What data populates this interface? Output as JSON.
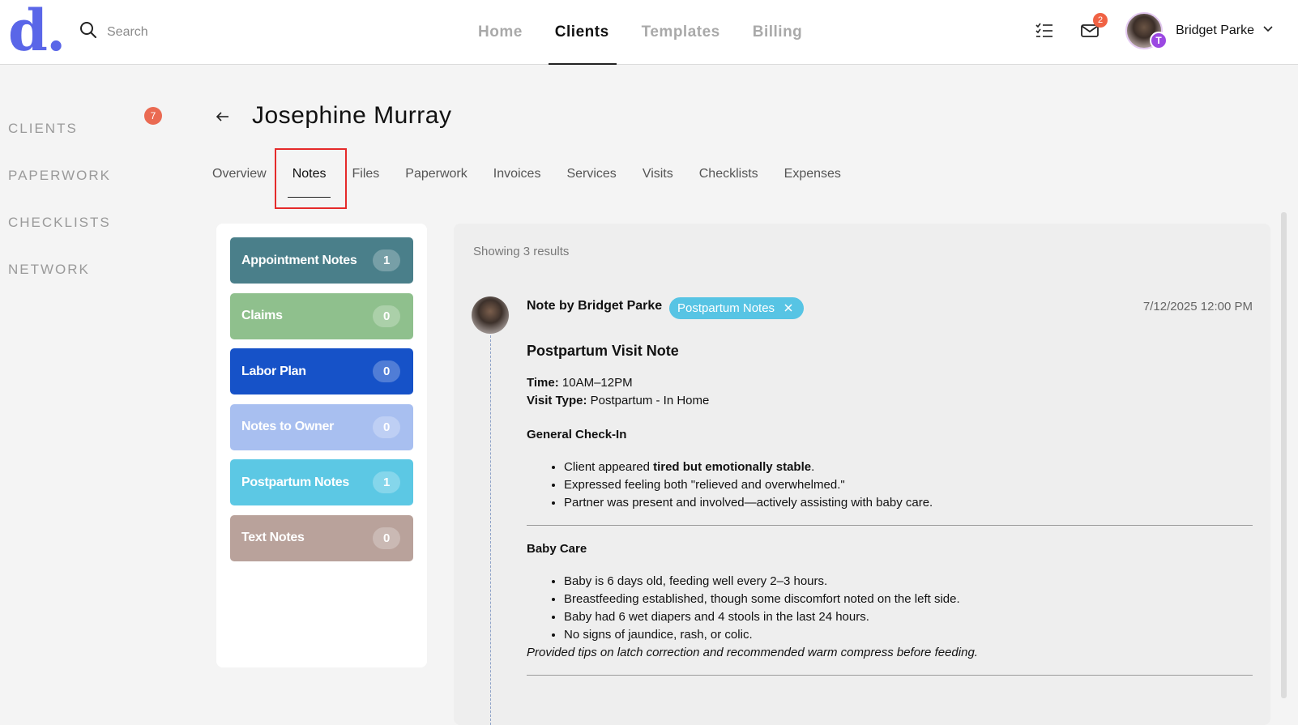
{
  "app": {
    "logo": "d."
  },
  "search": {
    "placeholder": "Search"
  },
  "nav": [
    {
      "label": "Home"
    },
    {
      "label": "Clients"
    },
    {
      "label": "Templates"
    },
    {
      "label": "Billing"
    }
  ],
  "header": {
    "mail_count": "2",
    "user_name": "Bridget Parke",
    "avatar_initial": "T"
  },
  "sidebar": {
    "items": [
      {
        "label": "CLIENTS",
        "badge": "7"
      },
      {
        "label": "PAPERWORK"
      },
      {
        "label": "CHECKLISTS"
      },
      {
        "label": "NETWORK"
      }
    ]
  },
  "client": {
    "name": "Josephine Murray"
  },
  "tabs": [
    {
      "label": "Overview"
    },
    {
      "label": "Notes"
    },
    {
      "label": "Files"
    },
    {
      "label": "Paperwork"
    },
    {
      "label": "Invoices"
    },
    {
      "label": "Services"
    },
    {
      "label": "Visits"
    },
    {
      "label": "Checklists"
    },
    {
      "label": "Expenses"
    }
  ],
  "categories": [
    {
      "label": "Appointment Notes",
      "count": "1",
      "color": "#4a7f8a"
    },
    {
      "label": "Claims",
      "count": "0",
      "color": "#8fc08d"
    },
    {
      "label": "Labor Plan",
      "count": "0",
      "color": "#1652c8"
    },
    {
      "label": "Notes to Owner",
      "count": "0",
      "color": "#a8bff0"
    },
    {
      "label": "Postpartum Notes",
      "count": "1",
      "color": "#5cc8e4"
    },
    {
      "label": "Text Notes",
      "count": "0",
      "color": "#b9a29b"
    }
  ],
  "notes": {
    "results_text": "Showing 3 results",
    "note": {
      "author": "Note by Bridget Parke",
      "tag": "Postpartum Notes",
      "date": "7/12/2025 12:00 PM",
      "title": "Postpartum Visit Note",
      "time_label": "Time:",
      "time_value": " 10AM–12PM",
      "visit_type_label": "Visit Type:",
      "visit_type_value": " Postpartum - In Home",
      "section1_title": "General Check-In",
      "section1_item1_pre": "Client appeared ",
      "section1_item1_bold": "tired but emotionally stable",
      "section1_item1_post": ".",
      "section1_item2": "Expressed feeling both \"relieved and overwhelmed.\"",
      "section1_item3": "Partner was present and involved—actively assisting with baby care.",
      "section2_title": "Baby Care",
      "section2_items": [
        "Baby is 6 days old, feeding well every 2–3 hours.",
        "Breastfeeding established, though some discomfort noted on the left side.",
        "Baby had 6 wet diapers and 4 stools in the last 24 hours.",
        "No signs of jaundice, rash, or colic."
      ],
      "tip": "Provided tips on latch correction and recommended warm compress before feeding."
    }
  }
}
